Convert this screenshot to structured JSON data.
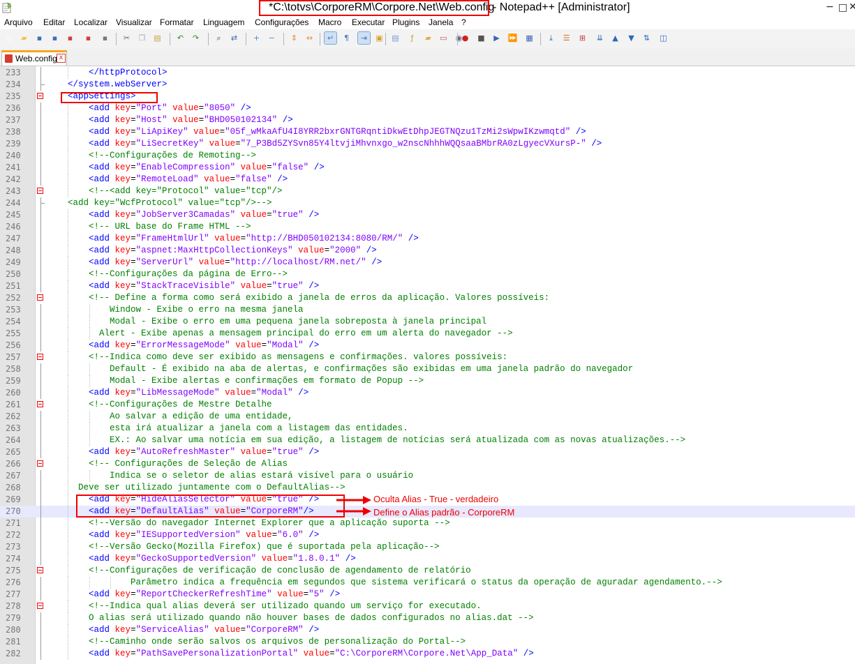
{
  "window": {
    "title_path": "*C:\\totvs\\CorporeRM\\Corpore.Net\\Web.config",
    "title_suffix": "- Notepad++ [Administrator]",
    "buttons": [
      "minimize",
      "maximize",
      "close"
    ]
  },
  "menu": [
    "Arquivo",
    "Editar",
    "Localizar",
    "Visualizar",
    "Formatar",
    "Linguagem",
    "Configurações",
    "Macro",
    "Executar",
    "Plugins",
    "Janela",
    "?"
  ],
  "toolbar": {
    "icons": [
      {
        "name": "new-file-icon",
        "color": "#ffffff"
      },
      {
        "name": "open-file-icon",
        "color": "#f2c54a"
      },
      {
        "name": "save-icon",
        "color": "#3f6fb8"
      },
      {
        "name": "save-all-icon",
        "color": "#3f6fb8"
      },
      {
        "name": "close-icon",
        "color": "#d04040"
      },
      {
        "name": "close-all-icon",
        "color": "#d04040"
      },
      {
        "name": "print-icon",
        "color": "#7a7a7a"
      },
      {
        "name": "cut-icon",
        "color": "#6a6a6a"
      },
      {
        "name": "copy-icon",
        "color": "#9ab0c9"
      },
      {
        "name": "paste-icon",
        "color": "#c9a04a"
      },
      {
        "name": "undo-icon",
        "color": "#3a8a3a"
      },
      {
        "name": "redo-icon",
        "color": "#3a8a3a"
      },
      {
        "name": "find-icon",
        "color": "#444444"
      },
      {
        "name": "replace-icon",
        "color": "#3a66b0"
      },
      {
        "name": "zoom-in-icon",
        "color": "#4a8bd0"
      },
      {
        "name": "zoom-out-icon",
        "color": "#4a8bd0"
      },
      {
        "name": "sync-vertical-icon",
        "color": "#e88a2a"
      },
      {
        "name": "sync-horizontal-icon",
        "color": "#e88a2a"
      },
      {
        "name": "word-wrap-icon",
        "color": "#4a7ac0",
        "active": true
      },
      {
        "name": "show-all-chars-icon",
        "color": "#4a7ac0"
      },
      {
        "name": "indent-guide-icon",
        "color": "#4a7ac0",
        "active": true
      },
      {
        "name": "user-language-icon",
        "color": "#d8a030"
      },
      {
        "name": "doc-map-icon",
        "color": "#7a9ad0"
      },
      {
        "name": "function-list-icon",
        "color": "#c8a040"
      },
      {
        "name": "folder-workspace-icon",
        "color": "#e0b040"
      },
      {
        "name": "doc-switcher-icon",
        "color": "#c05050"
      },
      {
        "name": "monitoring-icon",
        "color": "#5a6a8a"
      },
      {
        "name": "record-macro-icon",
        "color": "#d02020"
      },
      {
        "name": "stop-record-icon",
        "color": "#555555"
      },
      {
        "name": "play-macro-icon",
        "color": "#3a66b0"
      },
      {
        "name": "play-multiple-icon",
        "color": "#3a66b0"
      },
      {
        "name": "save-macro-icon",
        "color": "#3a66b0"
      },
      {
        "name": "plugin-down-icon",
        "color": "#2a6ab8"
      },
      {
        "name": "plugin-list-icon",
        "color": "#d07020"
      },
      {
        "name": "plugin-compare-icon",
        "color": "#c04040"
      },
      {
        "name": "collapse-icon",
        "color": "#2a6ab8"
      },
      {
        "name": "arrow-up-icon",
        "color": "#2a6ab8"
      },
      {
        "name": "arrow-down-icon",
        "color": "#2a6ab8"
      },
      {
        "name": "sort-icon",
        "color": "#2a6ab8"
      },
      {
        "name": "panel-icon",
        "color": "#2a6ab8"
      }
    ]
  },
  "tab": {
    "label": "Web.config",
    "close_glyph": "x"
  },
  "editor": {
    "first_line_number": 233,
    "current_line": 270,
    "lines": [
      "        </httpProtocol>",
      "    </system.webServer>",
      "    <appSettings>",
      "        <add key=\"Port\" value=\"8050\" />",
      "        <add key=\"Host\" value=\"BHD050102134\" />",
      "        <add key=\"LiApiKey\" value=\"05f_wMkaAfU4I8YRR2bxrGNTGRqntiDkwEtDhpJEGTNQzu1TzMi2sWpwIKzwmqtd\" />",
      "        <add key=\"LiSecretKey\" value=\"7_P3Bd5ZYSvn85Y4ltvjiMhvnxgo_w2nscNhhhWQQsaaBMbrRA0zLgyecVXursP-\" />",
      "        <!--Configurações de Remoting-->",
      "        <add key=\"EnableCompression\" value=\"false\" />",
      "        <add key=\"RemoteLoad\" value=\"false\" />",
      "        <!--<add key=\"Protocol\" value=\"tcp\"/>",
      "    <add key=\"WcfProtocol\" value=\"tcp\"/>-->",
      "        <add key=\"JobServer3Camadas\" value=\"true\" />",
      "        <!-- URL base do Frame HTML -->",
      "        <add key=\"FrameHtmlUrl\" value=\"http://BHD050102134:8080/RM/\" />",
      "        <add key=\"aspnet:MaxHttpCollectionKeys\" value=\"2000\" />",
      "        <add key=\"ServerUrl\" value=\"http://localhost/RM.net/\" />",
      "        <!--Configurações da página de Erro-->",
      "        <add key=\"StackTraceVisible\" value=\"true\" />",
      "        <!-- Define a forma como será exibido a janela de erros da aplicação. Valores possíveis:",
      "            Window - Exibe o erro na mesma janela",
      "            Modal - Exibe o erro em uma pequena janela sobreposta à janela principal",
      "          Alert - Exibe apenas a mensagem principal do erro em um alerta do navegador -->",
      "        <add key=\"ErrorMessageMode\" value=\"Modal\" />",
      "        <!--Indica como deve ser exibido as mensagens e confirmações. valores possíveis:",
      "            Default - É exibido na aba de alertas, e confirmações são exibidas em uma janela padrão do navegador",
      "            Modal - Exibe alertas e confirmações em formato de Popup -->",
      "        <add key=\"LibMessageMode\" value=\"Modal\" />",
      "        <!--Configurações de Mestre Detalhe",
      "            Ao salvar a edição de uma entidade,",
      "            esta irá atualizar a janela com a listagem das entidades.",
      "            EX.: Ao salvar uma notícia em sua edição, a listagem de notícias será atualizada com as novas atualizações.-->",
      "        <add key=\"AutoRefreshMaster\" value=\"true\" />",
      "        <!-- Configurações de Seleção de Alias",
      "            Indica se o seletor de alias estará visível para o usuário",
      "      Deve ser utilizado juntamente com o DefaultAlias-->",
      "        <add key=\"HideAliasSelector\" value=\"true\" />",
      "        <add key=\"DefaultAlias\" value=\"CorporeRM\"/>",
      "        <!--Versão do navegador Internet Explorer que a aplicação suporta -->",
      "        <add key=\"IESupportedVersion\" value=\"6.0\" />",
      "        <!--Versão Gecko(Mozilla Firefox) que é suportada pela aplicação-->",
      "        <add key=\"GeckoSupportedVersion\" value=\"1.8.0.1\" />",
      "        <!--Configurações de verificação de conclusão de agendamento de relatório",
      "                Parâmetro indica a frequência em segundos que sistema verificará o status da operação de aguradar agendamento.-->",
      "        <add key=\"ReportCheckerRefreshTime\" value=\"5\" />",
      "        <!--Indica qual alias deverá ser utilizado quando um serviço for executado.",
      "        O alias será utilizado quando não houver bases de dados configurados no alias.dat -->",
      "        <add key=\"ServiceAlias\" value=\"CorporeRM\" />",
      "        <!--Caminho onde serão salvos os arquivos de personalização do Portal-->",
      "        <add key=\"PathSavePersonalizationPortal\" value=\"C:\\CorporeRM\\Corpore.Net\\App_Data\" />"
    ]
  },
  "annotations": {
    "note_hide_alias": "Oculta Alias - True - verdadeiro",
    "note_default_alias": "Define o Alias padrão - CorporeRM",
    "color": "#ee0000"
  }
}
